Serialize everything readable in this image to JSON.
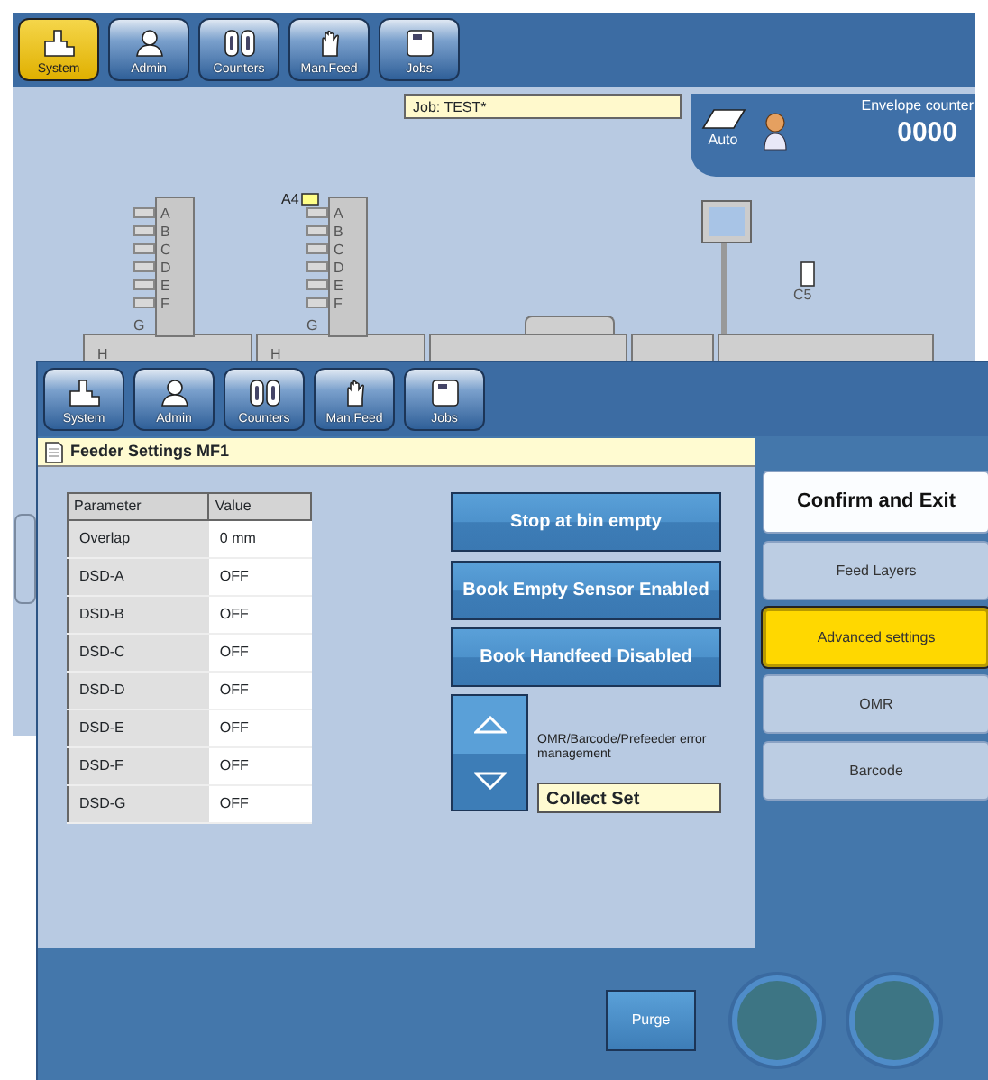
{
  "background_window": {
    "toolbar": [
      {
        "label": "System",
        "selected": true
      },
      {
        "label": "Admin",
        "selected": false
      },
      {
        "label": "Counters",
        "selected": false
      },
      {
        "label": "Man.Feed",
        "selected": false
      },
      {
        "label": "Jobs",
        "selected": false
      }
    ],
    "job_label": "Job: TEST*",
    "status_panel": {
      "mode": "Auto",
      "counter_label": "Envelope counter",
      "counter": "0000"
    },
    "machine": {
      "feeders": [
        {
          "stations": [
            "A",
            "B",
            "C",
            "D",
            "E",
            "F"
          ],
          "tray": "G",
          "base": "H"
        },
        {
          "paper_label": "A4",
          "stations": [
            "A",
            "B",
            "C",
            "D",
            "E",
            "F"
          ],
          "tray": "G",
          "base": "H"
        }
      ],
      "envelope_label": "C5"
    }
  },
  "foreground_window": {
    "toolbar": [
      {
        "label": "System",
        "selected": false
      },
      {
        "label": "Admin",
        "selected": false
      },
      {
        "label": "Counters",
        "selected": false
      },
      {
        "label": "Man.Feed",
        "selected": false
      },
      {
        "label": "Jobs",
        "selected": false
      }
    ],
    "title": "Feeder Settings MF1",
    "table": {
      "columns": [
        "Parameter",
        "Value"
      ],
      "rows": [
        [
          "Overlap",
          "0 mm"
        ],
        [
          "DSD-A",
          "OFF"
        ],
        [
          "DSD-B",
          "OFF"
        ],
        [
          "DSD-C",
          "OFF"
        ],
        [
          "DSD-D",
          "OFF"
        ],
        [
          "DSD-E",
          "OFF"
        ],
        [
          "DSD-F",
          "OFF"
        ],
        [
          "DSD-G",
          "OFF"
        ]
      ]
    },
    "buttons": [
      "Stop at bin empty",
      "Book Empty Sensor Enabled",
      "Book Handfeed Disabled"
    ],
    "error_mode": {
      "label": "OMR/Barcode/Prefeeder error management",
      "value": "Collect Set"
    },
    "side_menu": [
      {
        "label": "Confirm and Exit",
        "kind": "confirm",
        "selected": false
      },
      {
        "label": "Feed Layers",
        "kind": "tab",
        "selected": false
      },
      {
        "label": "Advanced settings",
        "kind": "tab",
        "selected": true
      },
      {
        "label": "OMR",
        "kind": "tab",
        "selected": false
      },
      {
        "label": "Barcode",
        "kind": "tab",
        "selected": false
      }
    ],
    "purge_button": "Purge"
  }
}
